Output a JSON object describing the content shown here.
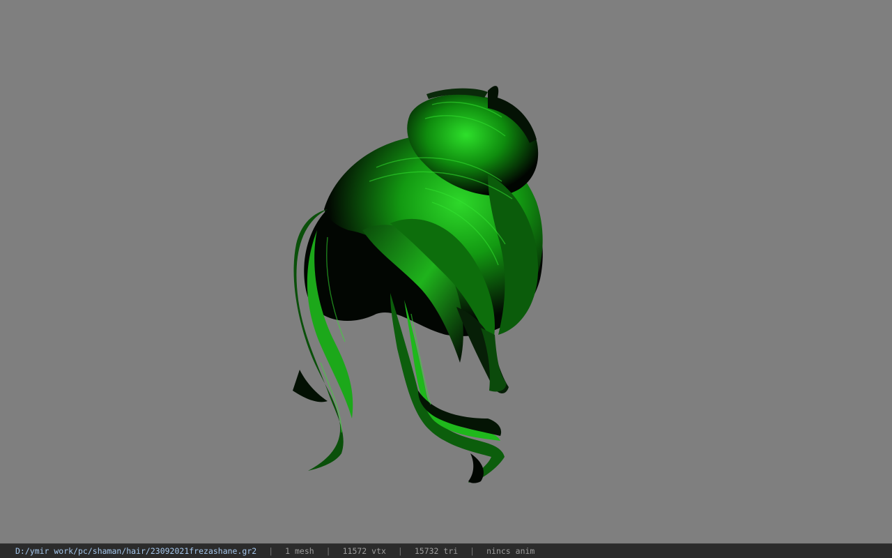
{
  "viewport": {
    "background_color": "#7f7f7f",
    "model": {
      "subject": "hair mesh",
      "primary_color": "#22c41f",
      "shadow_color": "#000000"
    }
  },
  "status_bar": {
    "file_path": "D:/ymir work/pc/shaman/hair/23092021frezashane.gr2",
    "separator": "|",
    "mesh_count": "1 mesh",
    "vertex_count": "11572 vtx",
    "triangle_count": "15732 tri",
    "anim_status": "nincs anim"
  }
}
